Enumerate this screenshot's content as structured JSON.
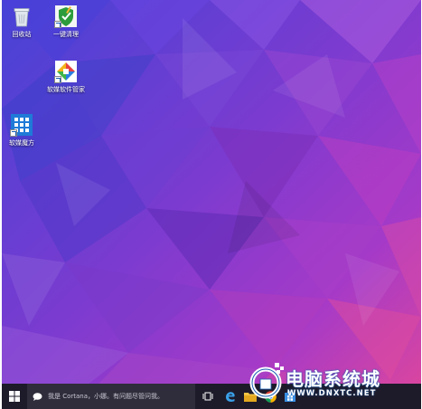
{
  "desktop": {
    "icons": [
      {
        "label": "回收站",
        "icon": "recycle-bin-icon"
      },
      {
        "label": "一键清理",
        "icon": "broom-shield-icon"
      },
      {
        "label": "软媒软件管家",
        "icon": "software-manager-icon"
      },
      {
        "label": "软媒魔方",
        "icon": "rubik-cube-icon"
      }
    ]
  },
  "taskbar": {
    "search_placeholder": "我是 Cortana，小娜。有问题尽管问我。",
    "apps": [
      "edge-icon",
      "file-explorer-icon",
      "chrome-icon",
      "store-icon"
    ]
  },
  "watermark": {
    "title": "电脑系统城",
    "url": "WWW.DNXTC.NET"
  },
  "colors": {
    "wallpaper_blue": "#3b3fc4",
    "wallpaper_purple": "#8a35c8",
    "wallpaper_pink": "#d83d9a",
    "taskbar": "#1d1b2a",
    "accent": "#1a5fb4"
  }
}
